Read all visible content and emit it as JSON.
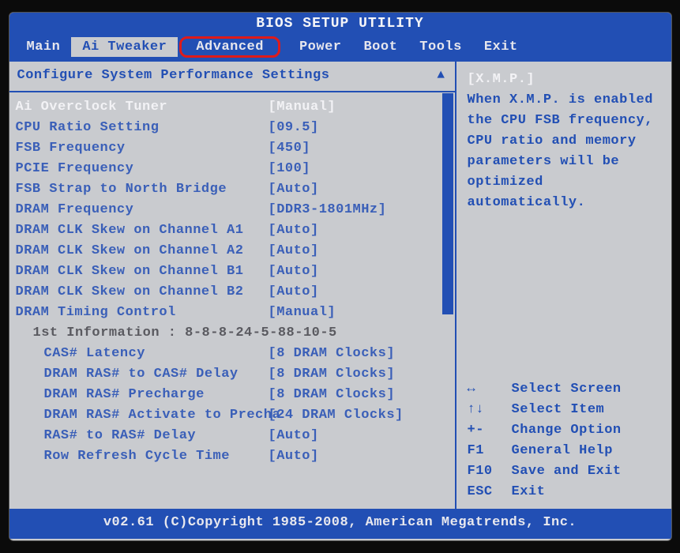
{
  "title": "BIOS SETUP UTILITY",
  "tabs": {
    "main": "Main",
    "ai_tweaker": "Ai Tweaker",
    "advanced": "Advanced",
    "power": "Power",
    "boot": "Boot",
    "tools": "Tools",
    "exit": "Exit"
  },
  "panel_title": "Configure System Performance Settings",
  "settings": {
    "ai_overclock_tuner": {
      "label": "Ai Overclock Tuner",
      "value": "[Manual]"
    },
    "cpu_ratio": {
      "label": "CPU Ratio Setting",
      "value": "[09.5]"
    },
    "fsb_frequency": {
      "label": "FSB Frequency",
      "value": "[450]"
    },
    "pcie_frequency": {
      "label": "PCIE Frequency",
      "value": "[100]"
    },
    "fsb_strap": {
      "label": "FSB Strap to North Bridge",
      "value": "[Auto]"
    },
    "dram_frequency": {
      "label": "DRAM Frequency",
      "value": "[DDR3-1801MHz]"
    },
    "dram_clk_a1": {
      "label": "DRAM CLK Skew on Channel A1",
      "value": "[Auto]"
    },
    "dram_clk_a2": {
      "label": "DRAM CLK Skew on Channel A2",
      "value": "[Auto]"
    },
    "dram_clk_b1": {
      "label": "DRAM CLK Skew on Channel B1",
      "value": "[Auto]"
    },
    "dram_clk_b2": {
      "label": "DRAM CLK Skew on Channel B2",
      "value": "[Auto]"
    },
    "dram_timing": {
      "label": "DRAM Timing Control",
      "value": "[Manual]"
    },
    "info1": "1st Information : 8-8-8-24-5-88-10-5",
    "cas_latency": {
      "label": "CAS# Latency",
      "value": "[8 DRAM Clocks]"
    },
    "ras_to_cas": {
      "label": "DRAM RAS# to CAS# Delay",
      "value": "[8 DRAM Clocks]"
    },
    "ras_precharge": {
      "label": "DRAM RAS# Precharge",
      "value": "[8 DRAM Clocks]"
    },
    "ras_activate": {
      "label": "DRAM RAS# Activate to Precha",
      "value": "[24 DRAM Clocks]"
    },
    "ras_to_ras": {
      "label": "RAS# to RAS# Delay",
      "value": "[Auto]"
    },
    "row_refresh": {
      "label": "Row Refresh Cycle Time",
      "value": "[Auto]"
    }
  },
  "help": {
    "title": "[X.M.P.]",
    "body1": "When X.M.P. is enabled",
    "body2": "the CPU FSB frequency,",
    "body3": "CPU ratio and memory",
    "body4": "parameters will be",
    "body5": "optimized",
    "body6": "automatically."
  },
  "legend": {
    "select_screen": {
      "key": "↔",
      "desc": "Select Screen"
    },
    "select_item": {
      "key": "↑↓",
      "desc": "Select Item"
    },
    "change_option": {
      "key": "+-",
      "desc": "Change Option"
    },
    "general_help": {
      "key": "F1",
      "desc": "General Help"
    },
    "save_exit": {
      "key": "F10",
      "desc": "Save and Exit"
    },
    "exit": {
      "key": "ESC",
      "desc": "Exit"
    }
  },
  "footer": "v02.61 (C)Copyright 1985-2008, American Megatrends, Inc."
}
